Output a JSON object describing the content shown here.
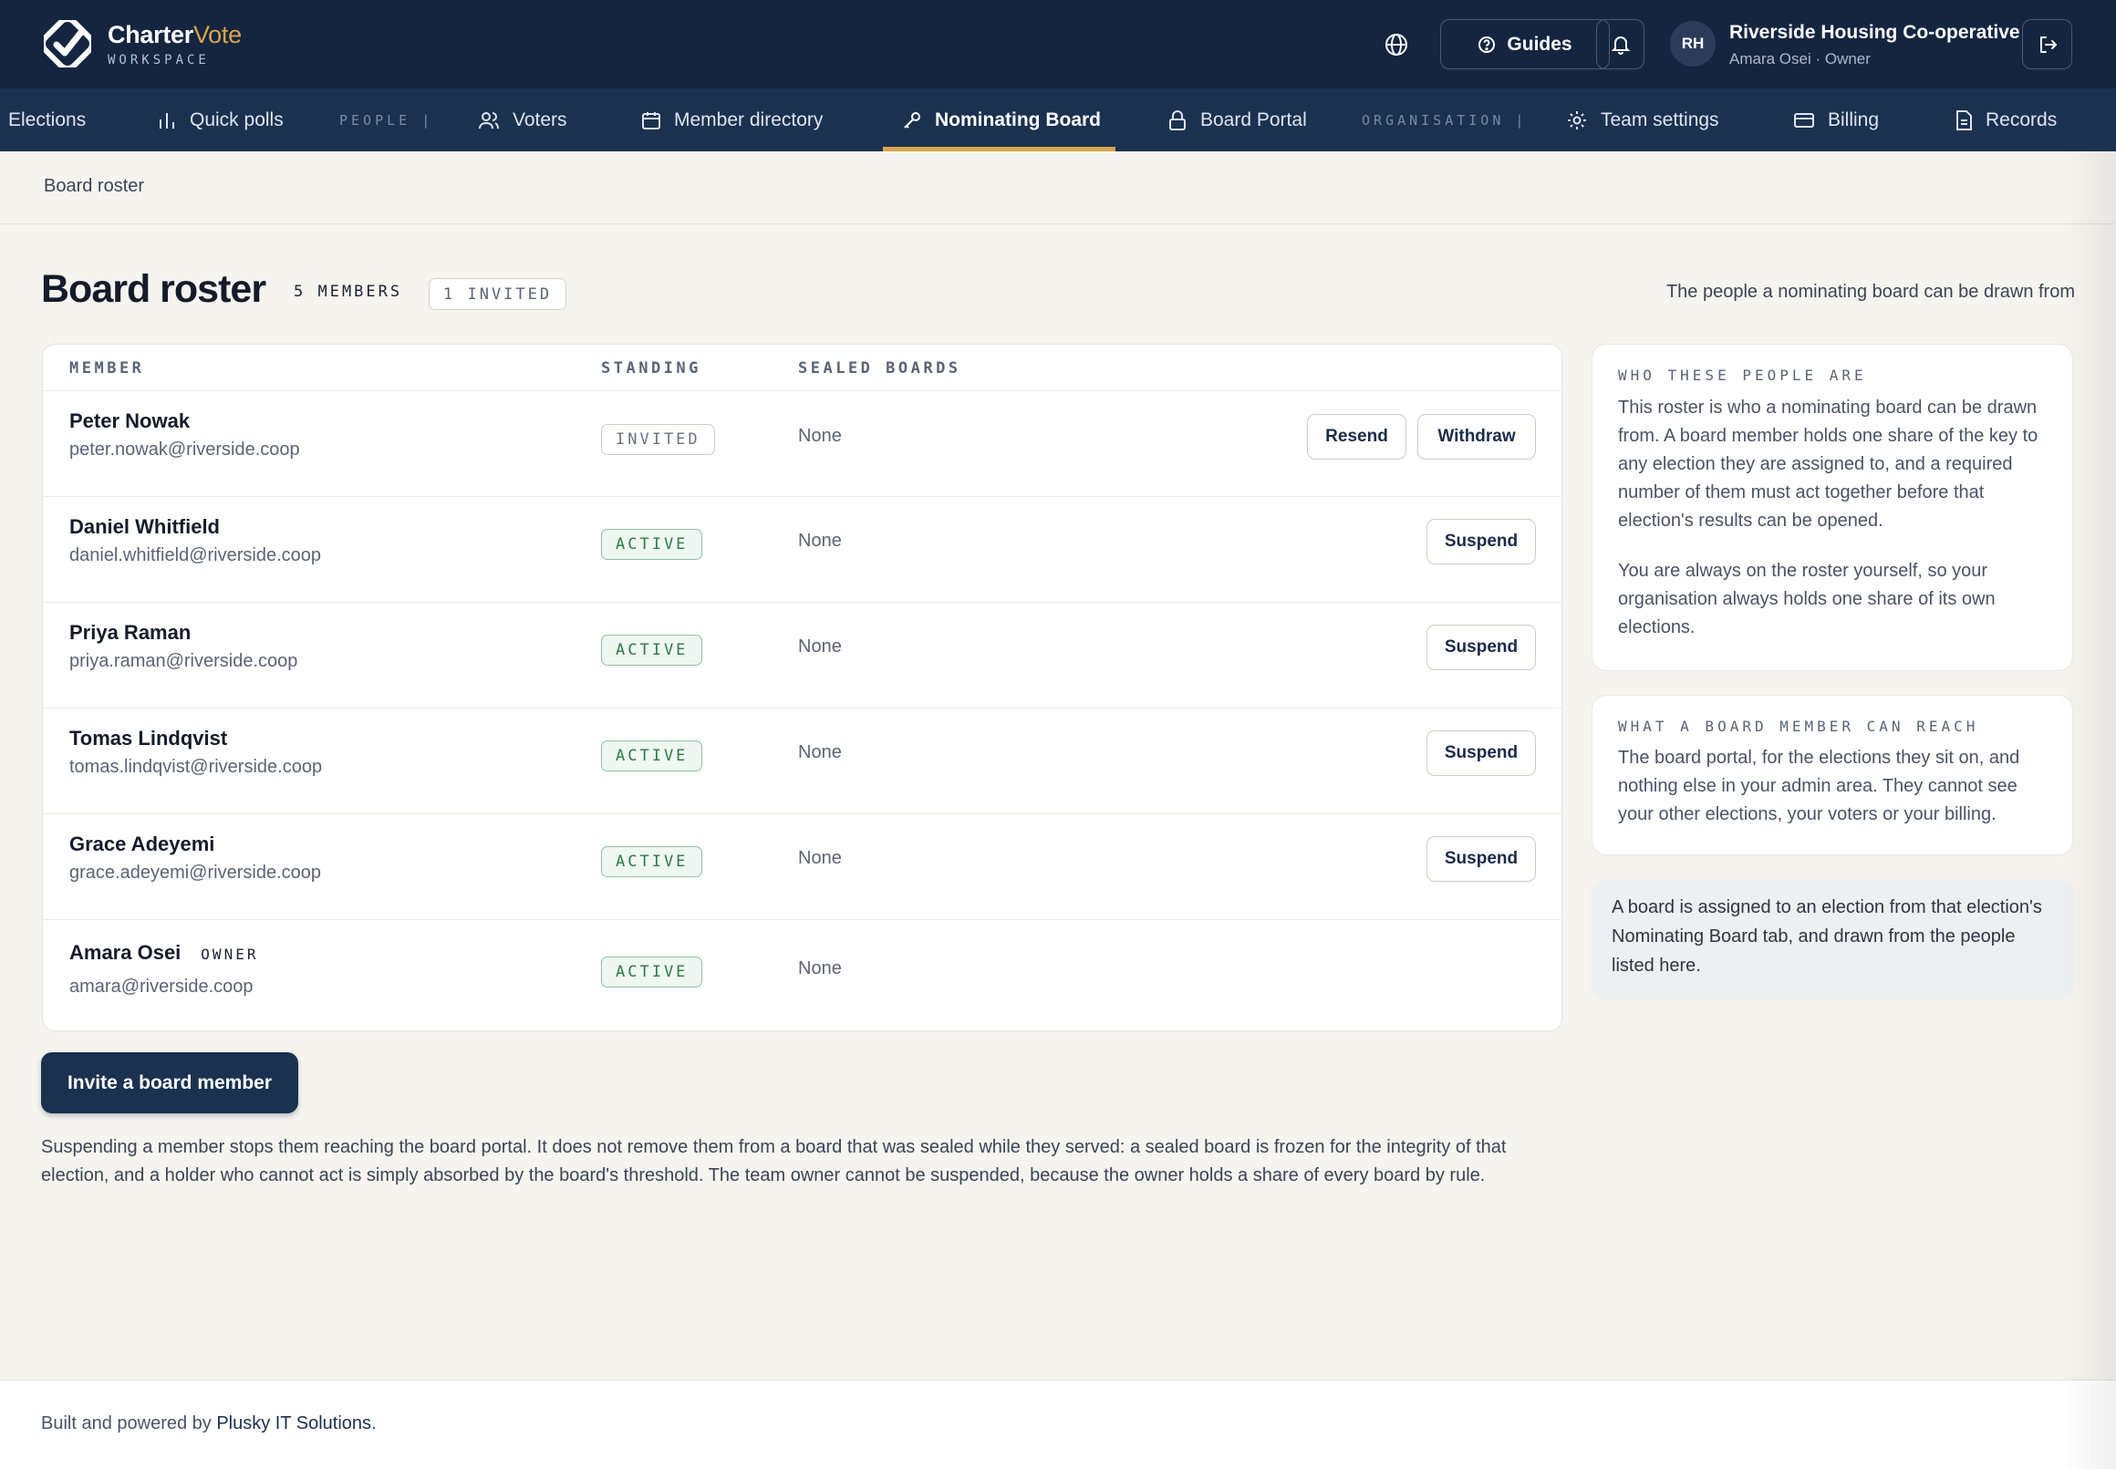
{
  "brand": {
    "name_main": "Charter",
    "name_accent": "Vote",
    "sub": "WORKSPACE"
  },
  "header": {
    "guides_label": "Guides",
    "avatar_initials": "RH",
    "org_name": "Riverside Housing Co-operative",
    "user_line": "Amara Osei · Owner"
  },
  "nav": {
    "elections": "Elections",
    "quick_polls": "Quick polls",
    "group_people": "PEOPLE",
    "voters": "Voters",
    "member_directory": "Member directory",
    "nominating_board": "Nominating Board",
    "board_portal": "Board Portal",
    "group_organisation": "ORGANISATION",
    "team_settings": "Team settings",
    "billing": "Billing",
    "records": "Records"
  },
  "breadcrumb": "Board roster",
  "page": {
    "title": "Board roster",
    "members_count": "5 MEMBERS",
    "invited_count": "1 INVITED",
    "subtitle": "The people a nominating board can be drawn from"
  },
  "table": {
    "headers": {
      "member": "MEMBER",
      "standing": "STANDING",
      "sealed": "SEALED BOARDS"
    },
    "rows": [
      {
        "name": "Peter Nowak",
        "email": "peter.nowak@riverside.coop",
        "standing": "INVITED",
        "sealed": "None",
        "actions": [
          "Resend",
          "Withdraw"
        ]
      },
      {
        "name": "Daniel Whitfield",
        "email": "daniel.whitfield@riverside.coop",
        "standing": "ACTIVE",
        "sealed": "None",
        "actions": [
          "Suspend"
        ]
      },
      {
        "name": "Priya Raman",
        "email": "priya.raman@riverside.coop",
        "standing": "ACTIVE",
        "sealed": "None",
        "actions": [
          "Suspend"
        ]
      },
      {
        "name": "Tomas Lindqvist",
        "email": "tomas.lindqvist@riverside.coop",
        "standing": "ACTIVE",
        "sealed": "None",
        "actions": [
          "Suspend"
        ]
      },
      {
        "name": "Grace Adeyemi",
        "email": "grace.adeyemi@riverside.coop",
        "standing": "ACTIVE",
        "sealed": "None",
        "actions": [
          "Suspend"
        ]
      },
      {
        "name": "Amara Osei",
        "owner_tag": "OWNER",
        "email": "amara@riverside.coop",
        "standing": "ACTIVE",
        "sealed": "None",
        "actions": []
      }
    ]
  },
  "invite_button": "Invite a board member",
  "note": "Suspending a member stops them reaching the board portal. It does not remove them from a board that was sealed while they served: a sealed board is frozen for the integrity of that election, and a holder who cannot act is simply absorbed by the board's threshold. The team owner cannot be suspended, because the owner holds a share of every board by rule.",
  "side": {
    "who_label": "WHO THESE PEOPLE ARE",
    "who_p1": "This roster is who a nominating board can be drawn from. A board member holds one share of the key to any election they are assigned to, and a required number of them must act together before that election's results can be opened.",
    "who_p2": "You are always on the roster yourself, so your organisation always holds one share of its own elections.",
    "reach_label": "WHAT A BOARD MEMBER CAN REACH",
    "reach_p": "The board portal, for the elections they sit on, and nothing else in your admin area. They cannot see your other elections, your voters or your billing.",
    "assign_note": "A board is assigned to an election from that election's Nominating Board tab, and drawn from the people listed here."
  },
  "footer": {
    "prefix": "Built and powered by ",
    "link": "Plusky IT Solutions",
    "suffix": "."
  },
  "colors": {
    "navy": "#142540",
    "accent": "#d9a54a",
    "active_green": "#2f7a48"
  }
}
